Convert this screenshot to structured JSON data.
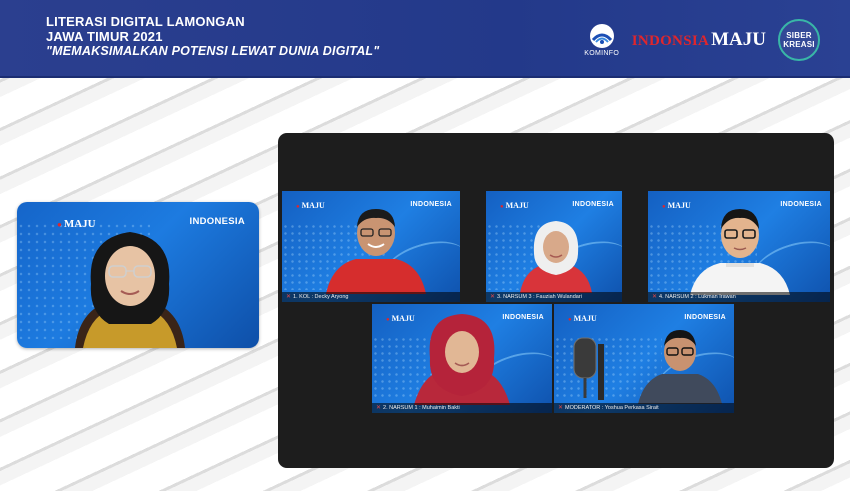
{
  "header": {
    "title_line1": "LITERASI DIGITAL LAMONGAN",
    "title_line2": "JAWA TIMUR 2021",
    "title_line3": "\"MEMAKSIMALKAN POTENSI LEWAT DUNIA DIGITAL\"",
    "logos": {
      "kominfo_label": "KOMINFO",
      "indonesia_word": "INDONSIA",
      "maju_word": "MAJU",
      "siber_line1": "SIBER",
      "siber_line2": "KREASI"
    }
  },
  "presenter": {
    "indonesia_tag": "INDONESIA",
    "maju_word": "MAJU"
  },
  "zoom": {
    "tiles": [
      {
        "indonesia_tag": "INDONESIA",
        "name": "1. KOL : Decky Aryong"
      },
      {
        "indonesia_tag": "INDONESIA",
        "name": "3. NARSUM 3 : Fauziah Wulandari"
      },
      {
        "indonesia_tag": "INDONESIA",
        "name": "4. NARSUM 2 : Lukman Irawan"
      },
      {
        "indonesia_tag": "INDONESIA",
        "name": "2. NARSUM 1 : Muhaimin Bakti"
      },
      {
        "indonesia_tag": "INDONESIA",
        "name": "MODERATOR : Yoshua Perkasa Sirait"
      }
    ]
  },
  "colors": {
    "header_bg": "#23398a",
    "brand_red": "#e0262c",
    "siber_teal": "#39b6a7",
    "zoom_bg": "#1d1d1d",
    "tile_blue": "#1f7fe3"
  }
}
